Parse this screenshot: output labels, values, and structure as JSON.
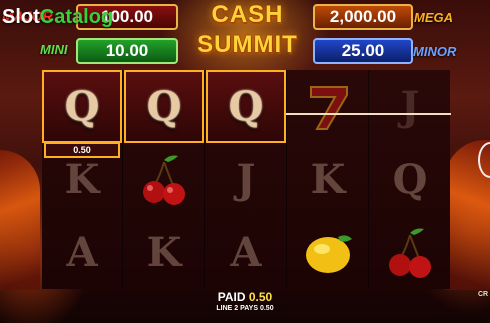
{
  "watermark": {
    "part1": "Slot",
    "part2": "Catalog"
  },
  "logo": {
    "line1": "CASH",
    "line2": "SUMMIT"
  },
  "jackpots": {
    "major": {
      "label": "MAJOR",
      "value": "100.00"
    },
    "mini": {
      "label": "MINI",
      "value": "10.00"
    },
    "mega": {
      "label": "MEGA",
      "value": "2,000.00"
    },
    "minor": {
      "label": "MINOR",
      "value": "25.00"
    }
  },
  "reels": [
    {
      "symbols": [
        "Q",
        "K",
        "A"
      ],
      "winning": [
        true,
        false,
        false
      ]
    },
    {
      "symbols": [
        "Q",
        "cherries",
        "K"
      ],
      "winning": [
        true,
        false,
        false
      ]
    },
    {
      "symbols": [
        "Q",
        "J",
        "A"
      ],
      "winning": [
        true,
        false,
        false
      ]
    },
    {
      "symbols": [
        "seven",
        "K",
        "lemon"
      ],
      "winning": [
        false,
        false,
        false
      ]
    },
    {
      "symbols": [
        "J",
        "Q",
        "cherries"
      ],
      "winning": [
        false,
        false,
        false
      ]
    }
  ],
  "win_label": "0.50",
  "paid": {
    "label": "PAID",
    "value": "0.50"
  },
  "line_pays": "LINE 2 PAYS 0.50",
  "side_label": "CR",
  "colors": {
    "accent": "#ffb020",
    "paid_value": "#ffe14a"
  }
}
